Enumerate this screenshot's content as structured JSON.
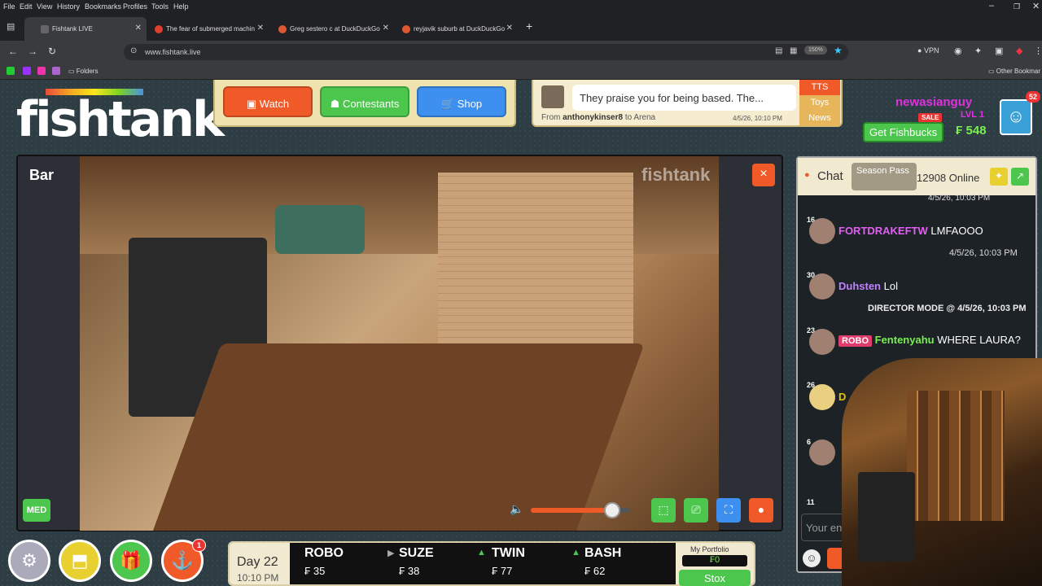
{
  "browser": {
    "menu": [
      "File",
      "Edit",
      "View",
      "History",
      "Bookmarks",
      "Profiles",
      "Tools",
      "Help"
    ],
    "tabs": [
      {
        "label": "Fishtank LIVE",
        "color": "#444"
      },
      {
        "label": "The fear of submerged machin",
        "color": "#e03d2e"
      },
      {
        "label": "Greg sestero c at DuckDuckGo",
        "color": "#de5833"
      },
      {
        "label": "reyjavik suburb at DuckDuckGo",
        "color": "#de5833"
      }
    ],
    "url": "www.fishtank.live",
    "zoom": "150%",
    "vpn": "VPN",
    "bookmarks_folder": "Folders",
    "other_bookmarks": "Other Bookmar"
  },
  "site": {
    "logo": "fishtank",
    "logo_mark": "©",
    "nav": [
      {
        "label": "Watch",
        "color": "#f05a28",
        "icon": "tv-icon"
      },
      {
        "label": "Contestants",
        "color": "#4cc64c",
        "icon": "contestants-icon"
      },
      {
        "label": "Shop",
        "color": "#3d8ff0",
        "icon": "cart-icon"
      }
    ],
    "tts": {
      "message": "They praise you for being based. The...",
      "from_label": "From",
      "from_user": "anthonykinser8",
      "to_label": "to",
      "to_room": "Arena",
      "time": "4/5/26, 10:10 PM",
      "tabs": [
        "TTS",
        "Toys",
        "News"
      ]
    },
    "user": {
      "name": "newasianguy",
      "level": "LVL 1",
      "sale": "SALE",
      "get_fishbucks": "Get Fishbucks",
      "balance": "₣ 548",
      "notifications": "52"
    }
  },
  "player": {
    "room": "Bar",
    "quality": "MED",
    "close": "×",
    "volume": 0.82,
    "watermark": "fishtank"
  },
  "chat": {
    "tab": "Chat",
    "season_pass": "Season Pass",
    "online": "12908 Online",
    "top_time": "4/5/26, 10:03 PM",
    "messages": [
      {
        "level": "16",
        "user": "FORTDRAKEFTW",
        "text": "LMFAOOO",
        "color": "#e060f0",
        "time": "4/5/26, 10:03 PM"
      },
      {
        "level": "30",
        "user": "Duhsten",
        "text": "Lol",
        "color": "#c080ff",
        "time": ""
      },
      {
        "level": "23",
        "badge": "ROBO",
        "user": "Fentenyahu",
        "text": "WHERE LAURA?",
        "color": "#7aef50",
        "time": ""
      },
      {
        "level": "26",
        "user": "D",
        "text": "",
        "color": "#e5c000",
        "time": ""
      },
      {
        "level": "6",
        "user": "",
        "text": "",
        "color": "#40d0ff",
        "time": ""
      },
      {
        "level": "11",
        "user": "",
        "text": "",
        "color": "#fff",
        "time": ""
      }
    ],
    "director_mode": "DIRECTOR MODE @ 4/5/26, 10:03 PM",
    "input_placeholder": "Your en"
  },
  "bottom": {
    "day": "Day 22",
    "clock": "10:10 PM",
    "notif_count": "1",
    "stocks": [
      {
        "name": "ROBO",
        "price": "₣ 35",
        "trend": "none"
      },
      {
        "name": "SUZE",
        "price": "₣ 38",
        "trend": "flat"
      },
      {
        "name": "TWIN",
        "price": "₣ 77",
        "trend": "up"
      },
      {
        "name": "BASH",
        "price": "₣ 62",
        "trend": "up"
      }
    ],
    "portfolio_label": "My Portfolio",
    "portfolio_value": "₣0",
    "stox": "Stox"
  }
}
